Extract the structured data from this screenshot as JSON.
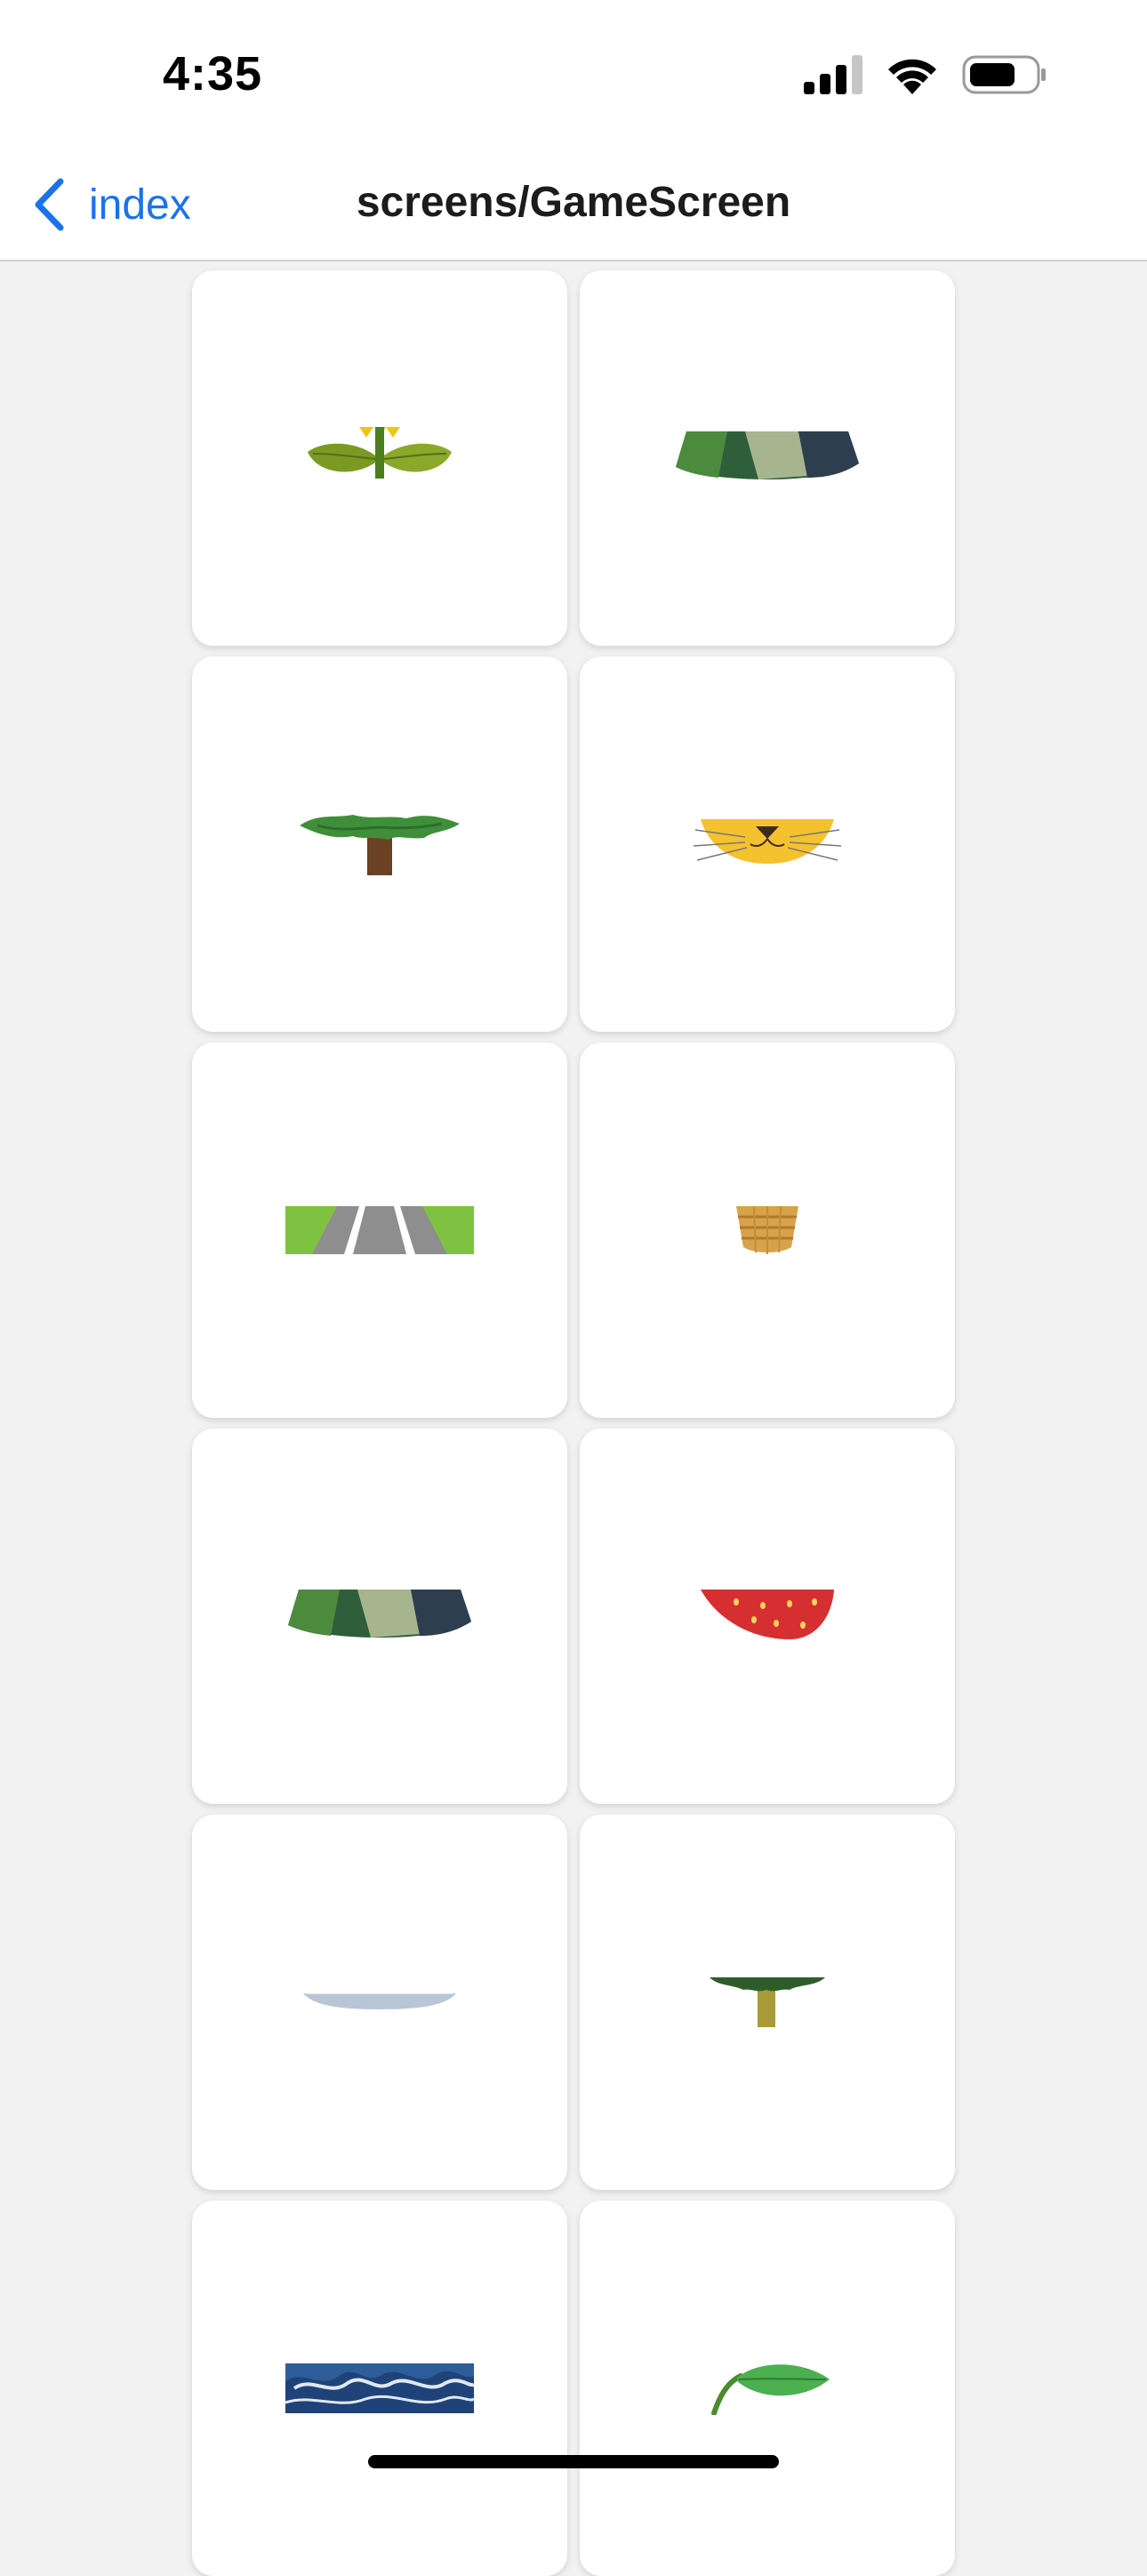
{
  "status_bar": {
    "time": "4:35",
    "icons": [
      "cellular-signal-icon",
      "wifi-icon",
      "battery-icon"
    ]
  },
  "nav": {
    "back_label": "index",
    "back_icon": "chevron-left-icon",
    "title": "screens/GameScreen",
    "accent_color": "#1a73e8"
  },
  "grid": {
    "tiles": [
      {
        "image": "sunflower-bottom"
      },
      {
        "image": "mountain-bottom"
      },
      {
        "image": "tree-bottom"
      },
      {
        "image": "cat-face-bottom"
      },
      {
        "image": "road-bottom"
      },
      {
        "image": "basket-bottom"
      },
      {
        "image": "mountain-bottom"
      },
      {
        "image": "strawberry-bottom"
      },
      {
        "image": "plate-bottom"
      },
      {
        "image": "tree-small-bottom"
      },
      {
        "image": "wave-bottom"
      },
      {
        "image": "leaf-bottom"
      }
    ]
  }
}
